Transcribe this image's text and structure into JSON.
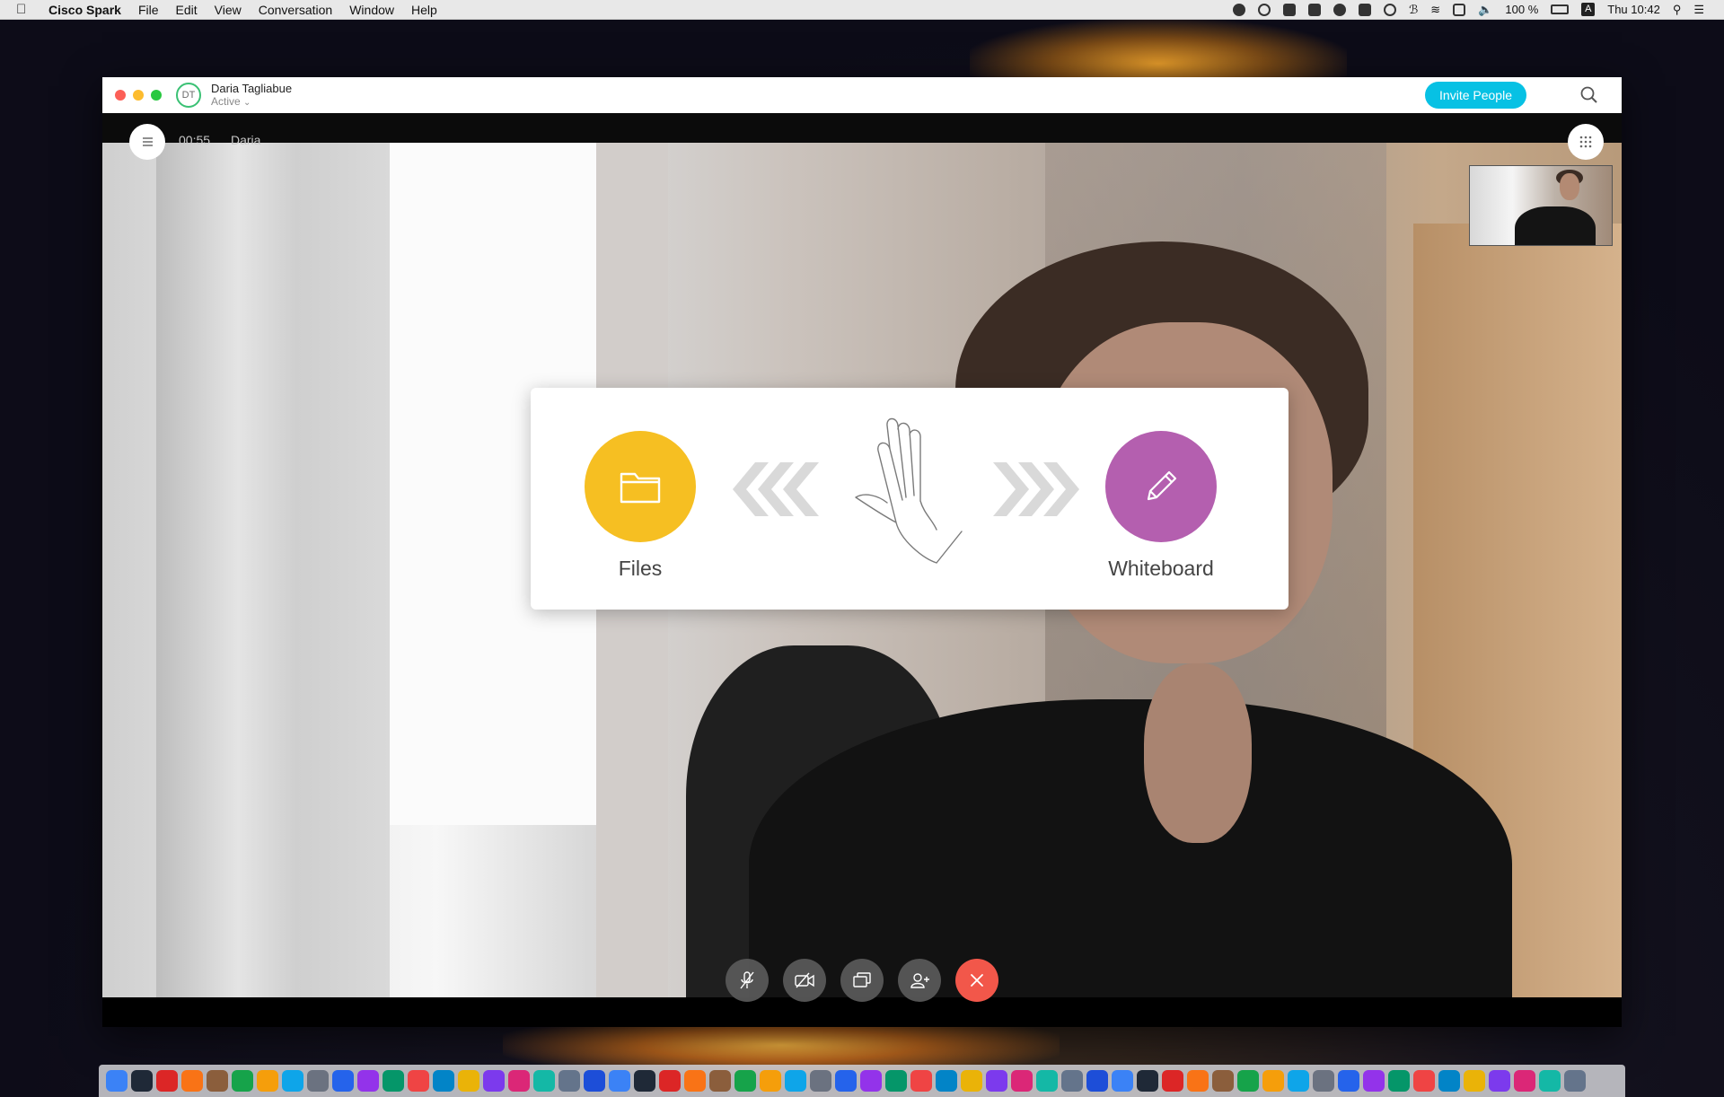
{
  "menubar": {
    "app_name": "Cisco Spark",
    "items": [
      "File",
      "Edit",
      "View",
      "Conversation",
      "Window",
      "Help"
    ],
    "battery": "100 %",
    "input_source": "A",
    "clock": "Thu 10:42"
  },
  "window": {
    "contact_initials": "DT",
    "contact_name": "Daria Tagliabue",
    "contact_status": "Active",
    "invite_label": "Invite People"
  },
  "call": {
    "timer": "00:55",
    "caller_name": "Daria"
  },
  "share_panel": {
    "files_label": "Files",
    "whiteboard_label": "Whiteboard"
  },
  "colors": {
    "accent": "#07c1e4",
    "files": "#f6bf22",
    "whiteboard": "#b45faf",
    "end_call": "#f2574a",
    "presence": "#3ac174"
  },
  "controls": [
    "mute-mic-icon",
    "video-off-icon",
    "share-screen-icon",
    "add-person-icon",
    "end-call-icon"
  ],
  "dock": {
    "icons": [
      "finder",
      "siri",
      "vivaldi",
      "h-app",
      "photos-app",
      "drive",
      "pages",
      "skype",
      "grapher",
      "safari",
      "link",
      "launchpad",
      "vlc",
      "safari-compass",
      "chrome",
      "dropbox",
      "preview",
      "calendar",
      "books",
      "itunes",
      "spotify",
      "notes",
      "messages",
      "photos",
      "istat",
      "lightroom",
      "xd",
      "evernote",
      "acrobat",
      "premiere",
      "photoshop",
      "fireworks",
      "indesign",
      "illustrator",
      "after-effects",
      "keynote",
      "facetime",
      "imovie",
      "chrome2",
      "textedit",
      "numbers",
      "mail",
      "keynote2",
      "books2",
      "appstore",
      "automator",
      "disk-utility",
      "system-prefs",
      "scanner",
      "preview2",
      "powerpoint",
      "word",
      "excel",
      "acrobat2",
      "folder",
      "folder2",
      "terminal",
      "screenshot",
      "trash"
    ]
  }
}
